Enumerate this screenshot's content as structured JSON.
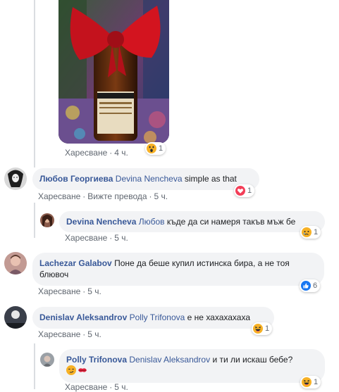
{
  "photo_comment": {
    "like_label": "Харесване",
    "time": "4 ч.",
    "reaction_count": "1",
    "reaction": "wow"
  },
  "comments": [
    {
      "author": "Любов Георгиева",
      "mention": "Devina Nencheva",
      "text": "simple as that",
      "like_label": "Харесване",
      "translate_label": "Вижте превода",
      "time": "5 ч.",
      "reaction": "love",
      "reaction_count": "1"
    },
    {
      "author": "Devina Nencheva",
      "mention": "Любов",
      "text": "къде да си намеря такъв мъж бе",
      "like_label": "Харесване",
      "time": "5 ч.",
      "reaction": "sad",
      "reaction_count": "1"
    },
    {
      "author": "Lachezar Galabov",
      "text_line1": "Поне да беше купил истинска бира, а не тоя",
      "text_line2": "блювоч",
      "like_label": "Харесване",
      "time": "5 ч.",
      "reaction": "like",
      "reaction_count": "6"
    },
    {
      "author": "Denislav Aleksandrov",
      "mention": "Polly Trifonova",
      "text": "е не хахахахаха",
      "like_label": "Харесване",
      "time": "5 ч.",
      "reaction": "haha",
      "reaction_count": "1"
    },
    {
      "author": "Polly Trifonova",
      "mention": "Denislav Aleksandrov",
      "text": "и ти ли искаш бебе?",
      "like_label": "Харесване",
      "time": "5 ч.",
      "reaction": "haha",
      "reaction_count": "1",
      "inline_emojis": [
        "smirk-emoji",
        "kiss-mark-emoji"
      ]
    }
  ],
  "separator": "·",
  "colors": {
    "link": "#385898",
    "bubble": "#f2f3f5",
    "meta": "#606770",
    "like_blue": "#1877f2",
    "love_red": "#f33e58",
    "emoji_yellow": "#f7b125"
  }
}
